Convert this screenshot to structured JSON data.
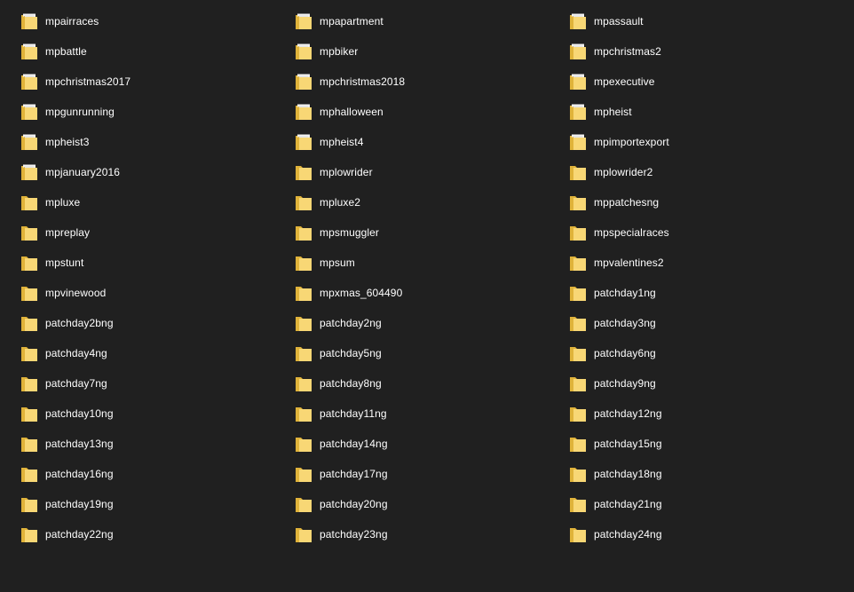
{
  "folders": [
    [
      {
        "name": "mpairraces",
        "icon": "folder-with-documents-icon"
      },
      {
        "name": "mpbattle",
        "icon": "folder-with-documents-icon"
      },
      {
        "name": "mpchristmas2017",
        "icon": "folder-with-documents-icon"
      },
      {
        "name": "mpgunrunning",
        "icon": "folder-with-documents-icon"
      },
      {
        "name": "mpheist3",
        "icon": "folder-with-documents-icon"
      },
      {
        "name": "mpjanuary2016",
        "icon": "folder-with-documents-icon"
      },
      {
        "name": "mpluxe",
        "icon": "folder-icon"
      },
      {
        "name": "mpreplay",
        "icon": "folder-icon"
      },
      {
        "name": "mpstunt",
        "icon": "folder-icon"
      },
      {
        "name": "mpvinewood",
        "icon": "folder-icon"
      },
      {
        "name": "patchday2bng",
        "icon": "folder-icon"
      },
      {
        "name": "patchday4ng",
        "icon": "folder-icon"
      },
      {
        "name": "patchday7ng",
        "icon": "folder-icon"
      },
      {
        "name": "patchday10ng",
        "icon": "folder-icon"
      },
      {
        "name": "patchday13ng",
        "icon": "folder-icon"
      },
      {
        "name": "patchday16ng",
        "icon": "folder-icon"
      },
      {
        "name": "patchday19ng",
        "icon": "folder-icon"
      },
      {
        "name": "patchday22ng",
        "icon": "folder-icon"
      }
    ],
    [
      {
        "name": "mpapartment",
        "icon": "folder-with-documents-icon"
      },
      {
        "name": "mpbiker",
        "icon": "folder-with-documents-icon"
      },
      {
        "name": "mpchristmas2018",
        "icon": "folder-with-documents-icon"
      },
      {
        "name": "mphalloween",
        "icon": "folder-with-documents-icon"
      },
      {
        "name": "mpheist4",
        "icon": "folder-with-documents-icon"
      },
      {
        "name": "mplowrider",
        "icon": "folder-icon"
      },
      {
        "name": "mpluxe2",
        "icon": "folder-icon"
      },
      {
        "name": "mpsmuggler",
        "icon": "folder-icon"
      },
      {
        "name": "mpsum",
        "icon": "folder-icon"
      },
      {
        "name": "mpxmas_604490",
        "icon": "folder-icon"
      },
      {
        "name": "patchday2ng",
        "icon": "folder-icon"
      },
      {
        "name": "patchday5ng",
        "icon": "folder-icon"
      },
      {
        "name": "patchday8ng",
        "icon": "folder-icon"
      },
      {
        "name": "patchday11ng",
        "icon": "folder-icon"
      },
      {
        "name": "patchday14ng",
        "icon": "folder-icon"
      },
      {
        "name": "patchday17ng",
        "icon": "folder-icon"
      },
      {
        "name": "patchday20ng",
        "icon": "folder-icon"
      },
      {
        "name": "patchday23ng",
        "icon": "folder-icon"
      }
    ],
    [
      {
        "name": "mpassault",
        "icon": "folder-with-documents-icon"
      },
      {
        "name": "mpchristmas2",
        "icon": "folder-with-documents-icon"
      },
      {
        "name": "mpexecutive",
        "icon": "folder-with-documents-icon"
      },
      {
        "name": "mpheist",
        "icon": "folder-with-documents-icon"
      },
      {
        "name": "mpimportexport",
        "icon": "folder-with-documents-icon"
      },
      {
        "name": "mplowrider2",
        "icon": "folder-icon"
      },
      {
        "name": "mppatchesng",
        "icon": "folder-icon"
      },
      {
        "name": "mpspecialraces",
        "icon": "folder-icon"
      },
      {
        "name": "mpvalentines2",
        "icon": "folder-icon"
      },
      {
        "name": "patchday1ng",
        "icon": "folder-icon"
      },
      {
        "name": "patchday3ng",
        "icon": "folder-icon"
      },
      {
        "name": "patchday6ng",
        "icon": "folder-icon"
      },
      {
        "name": "patchday9ng",
        "icon": "folder-icon"
      },
      {
        "name": "patchday12ng",
        "icon": "folder-icon"
      },
      {
        "name": "patchday15ng",
        "icon": "folder-icon"
      },
      {
        "name": "patchday18ng",
        "icon": "folder-icon"
      },
      {
        "name": "patchday21ng",
        "icon": "folder-icon"
      },
      {
        "name": "patchday24ng",
        "icon": "folder-icon"
      }
    ]
  ],
  "colors": {
    "background": "#202020",
    "text": "#ffffff",
    "folder_back": "#e0b33a",
    "folder_front": "#f8d775",
    "folder_shadow": "#c9962a",
    "paper": "#f4f4f4"
  }
}
